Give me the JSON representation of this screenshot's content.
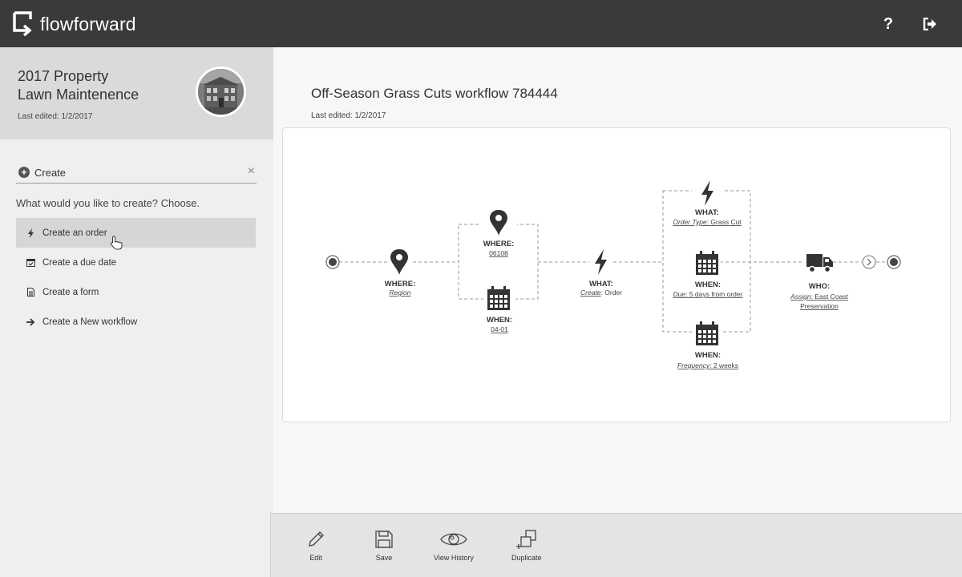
{
  "app": {
    "name": "flowforward"
  },
  "header": {
    "help_label": "?",
    "logout_icon": "logout-icon"
  },
  "project": {
    "title_line1": "2017 Property",
    "title_line2": "Lawn Maintenence",
    "last_edited": "Last edited: 1/2/2017"
  },
  "create_panel": {
    "label": "Create",
    "close": "×",
    "prompt": "What would you like to create? Choose.",
    "items": [
      {
        "label": "Create an order",
        "icon": "bolt-icon",
        "active": true
      },
      {
        "label": "Create a due date",
        "icon": "calendar-check-icon",
        "active": false
      },
      {
        "label": "Create a form",
        "icon": "document-icon",
        "active": false
      },
      {
        "label": "Create a New workflow",
        "icon": "arrow-right-icon",
        "active": false
      }
    ]
  },
  "workflow": {
    "title": "Off-Season Grass Cuts workflow 784444",
    "last_edited": "Last edited: 1/2/2017",
    "nodes": {
      "where_region": {
        "label": "WHERE:",
        "sub_key": "Region",
        "sub_value": ""
      },
      "where_zip": {
        "label": "WHERE:",
        "sub_value": "06108"
      },
      "when_date": {
        "label": "WHEN:",
        "sub_value": "04-01"
      },
      "what_create": {
        "label": "WHAT:",
        "sub_key": "Create",
        "sub_value": ": Order"
      },
      "what_type": {
        "label": "WHAT:",
        "sub_key": "Order Type",
        "sub_value": ": Grass Cut"
      },
      "when_due": {
        "label": "WHEN:",
        "sub_key": "Due",
        "sub_value": ": 5 days from order"
      },
      "when_freq": {
        "label": "WHEN:",
        "sub_key": "Frequency",
        "sub_value": ": 2 weeks"
      },
      "who": {
        "label": "WHO:",
        "sub_key": "Assign",
        "sub_value": ": East Coast",
        "sub_value2": "Preservation"
      }
    }
  },
  "toolbar": {
    "edit_label": "Edit",
    "save_label": "Save",
    "history_label": "View History",
    "duplicate_label": "Duplicate"
  }
}
